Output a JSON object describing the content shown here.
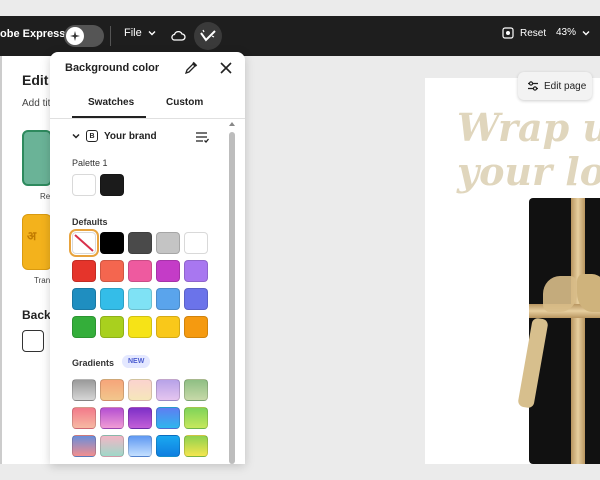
{
  "topbar": {
    "brand": "obe Express",
    "file_label": "File",
    "reset_label": "Reset",
    "zoom_label": "43%"
  },
  "left_panel": {
    "title": "Edit p",
    "subtitle": "Add titl",
    "thumb1_label": "Res",
    "thumb2_text": "अ",
    "thumb2_label": "Tran",
    "background_label": "Backg"
  },
  "popover": {
    "title": "Background color",
    "tabs": [
      {
        "label": "Swatches",
        "active": true
      },
      {
        "label": "Custom",
        "active": false
      }
    ],
    "brand_section": {
      "label": "Your brand",
      "badge": "B"
    },
    "palette": {
      "label": "Palette 1",
      "colors": [
        "#ffffff",
        "#1b1b1b"
      ]
    },
    "defaults": {
      "label": "Defaults",
      "rows": [
        [
          "none",
          "#000000",
          "#4a4a4a",
          "#c4c4c4",
          "#ffffff"
        ],
        [
          "#e5342b",
          "#f4664f",
          "#ee5a9f",
          "#c43cc7",
          "#a877f0"
        ],
        [
          "#1f8ec0",
          "#34bde8",
          "#7fe2f5",
          "#5aa4ec",
          "#6b73ea"
        ],
        [
          "#34ae3a",
          "#a9d01e",
          "#f6e317",
          "#f9c81a",
          "#f59a10"
        ]
      ]
    },
    "gradients": {
      "label": "Gradients",
      "badge": "NEW",
      "rows": [
        [
          [
            "#9a9a9a",
            "#d6d6d6"
          ],
          [
            "#f6a57a",
            "#f2c68c"
          ],
          [
            "#fbd3cf",
            "#f6e6ba"
          ],
          [
            "#b7a2e8",
            "#e5c5ef"
          ],
          [
            "#8fbf84",
            "#c7d9a8"
          ]
        ],
        [
          [
            "#f27a8a",
            "#f7b9a3"
          ],
          [
            "#b44fd1",
            "#f19cd5"
          ],
          [
            "#7d30c7",
            "#c25fd8"
          ],
          [
            "#5f7ef2",
            "#2eb6ee"
          ],
          [
            "#7fd35a",
            "#c6e85c"
          ]
        ],
        [
          [
            "#6a8dd9",
            "#f38f8f"
          ],
          [
            "#f2b6c6",
            "#9fd8c8"
          ],
          [
            "#5e98f2",
            "#c4e0ff"
          ],
          [
            "#1aa8f0",
            "#0f7fe0"
          ],
          [
            "#8fd14f",
            "#f5e64e"
          ]
        ]
      ]
    }
  },
  "canvas": {
    "headline_line1": "Wrap u",
    "headline_line2": "your lo",
    "edit_page_label": "Edit page"
  }
}
